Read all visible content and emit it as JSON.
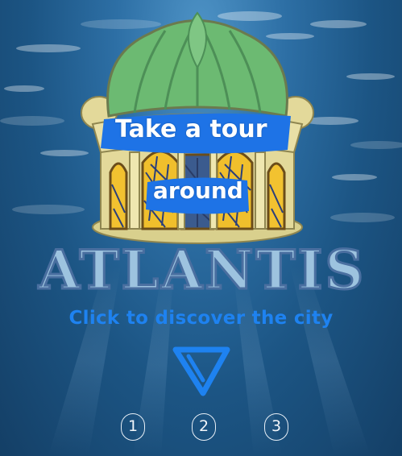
{
  "hero": {
    "line1": "Take a tour",
    "line2": "around"
  },
  "title": "ATLANTIS",
  "tagline": "Click to discover the city",
  "scroll_icon": "down-triangle-icon",
  "pager": {
    "pages": [
      "1",
      "2",
      "3"
    ]
  },
  "colors": {
    "water": "#245f94",
    "dome_green": "#69b86e",
    "dome_cream": "#e6dc9c",
    "brush_blue": "#1e73e6",
    "title_fill": "#9dc3df",
    "title_outline": "#4a6fa0",
    "tagline": "#1e82f0",
    "arrow": "#1e82f0"
  }
}
